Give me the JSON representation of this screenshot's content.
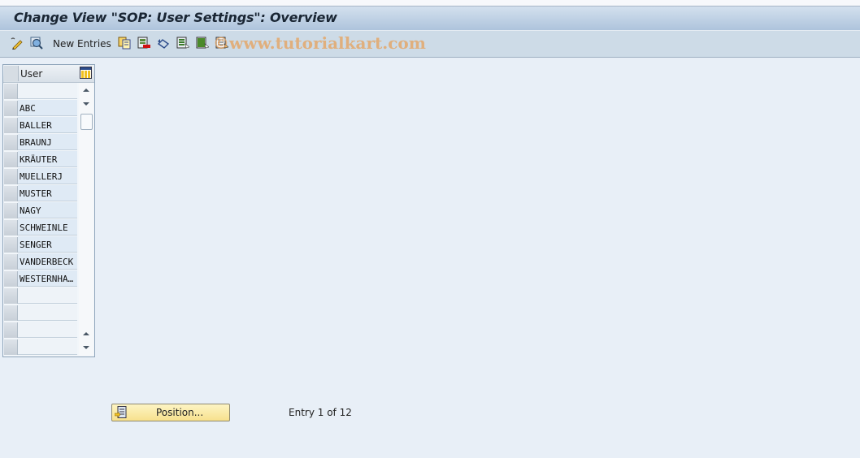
{
  "window": {
    "title": "Change View \"SOP: User Settings\": Overview"
  },
  "toolbar": {
    "items": [
      {
        "icon": "display-change-icon"
      },
      {
        "icon": "find-icon"
      },
      {
        "label": "New Entries"
      },
      {
        "icon": "copy-as-icon"
      },
      {
        "icon": "delete-icon"
      },
      {
        "icon": "undo-change-icon"
      },
      {
        "icon": "select-all-icon"
      },
      {
        "icon": "select-block-icon"
      },
      {
        "icon": "deselect-all-icon"
      }
    ],
    "new_entries_label": "New Entries"
  },
  "watermark": "©www.tutorialkart.com",
  "table": {
    "column_header": "User",
    "rows": [
      "",
      "ABC",
      "BALLER",
      "BRAUNJ",
      "KRÄUTER",
      "MUELLERJ",
      "MUSTER",
      "NAGY",
      "SCHWEINLE",
      "SENGER",
      "VANDERBECK",
      "WESTERNHA…",
      "",
      "",
      "",
      ""
    ]
  },
  "footer": {
    "position_button_label": "Position...",
    "entry_info": "Entry 1 of 12"
  }
}
